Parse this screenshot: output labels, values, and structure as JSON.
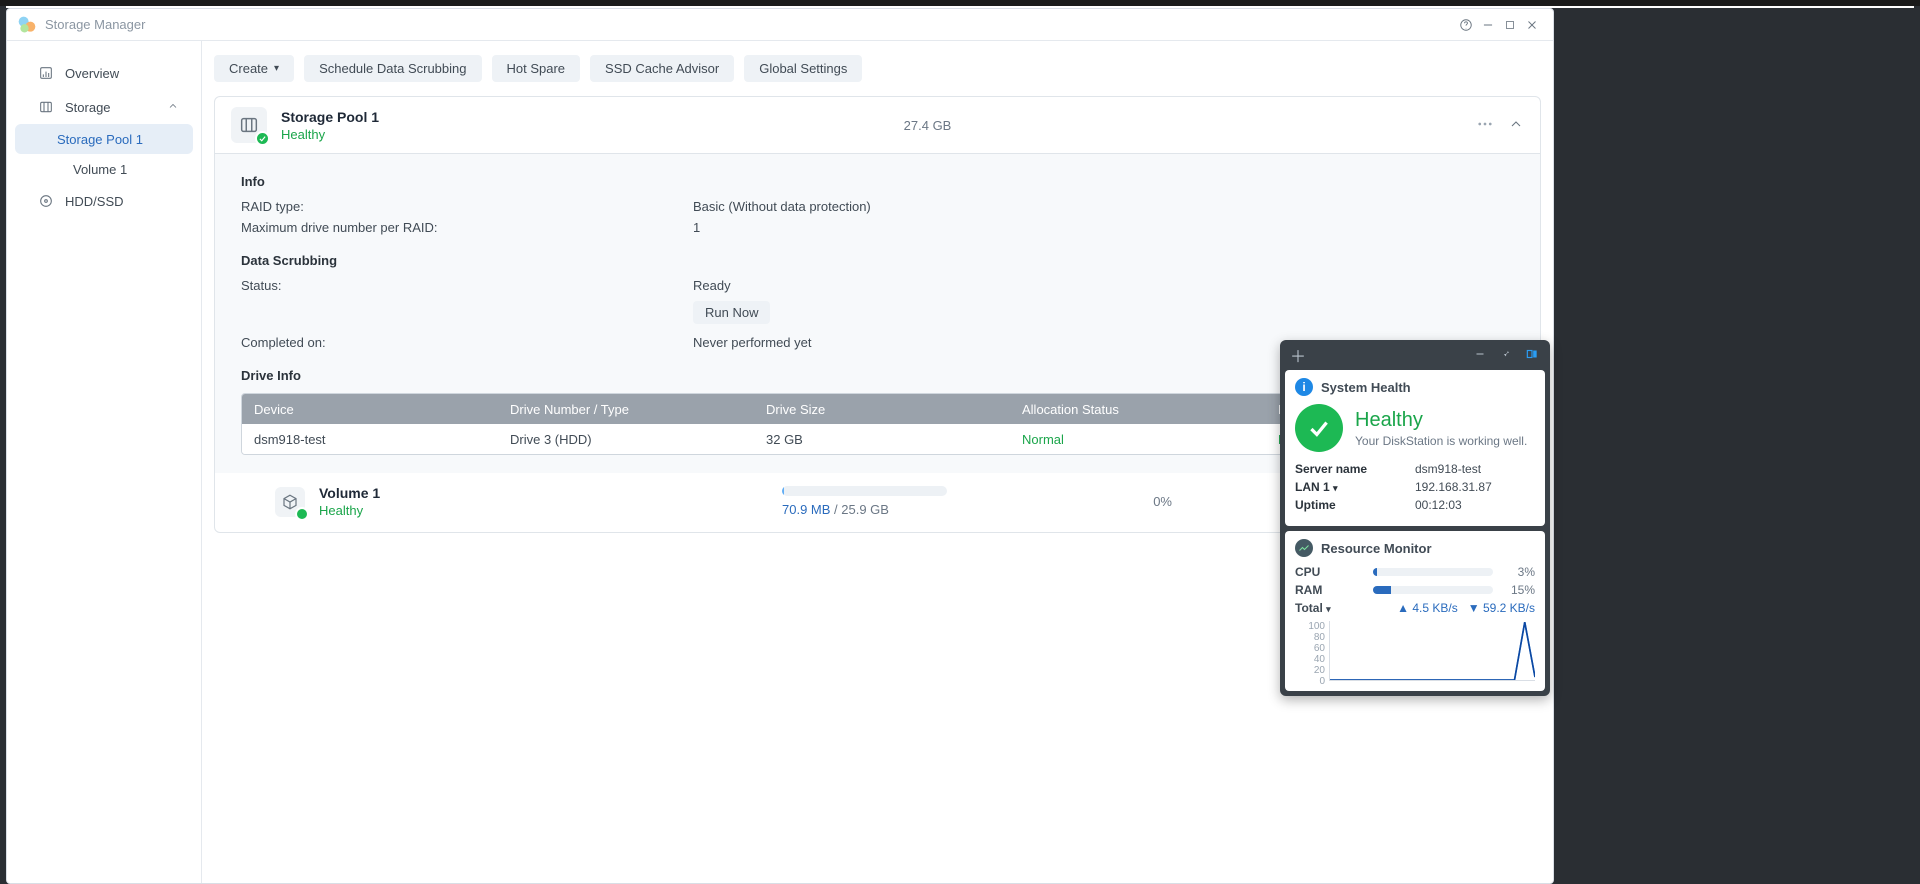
{
  "window": {
    "title": "Storage Manager"
  },
  "sidebar": {
    "overview": "Overview",
    "storage": "Storage",
    "storage_pool": "Storage Pool 1",
    "volume": "Volume 1",
    "hddssd": "HDD/SSD"
  },
  "toolbar": {
    "create": "Create",
    "schedule": "Schedule Data Scrubbing",
    "hotspare": "Hot Spare",
    "ssdcache": "SSD Cache Advisor",
    "global": "Global Settings"
  },
  "pool": {
    "name": "Storage Pool 1",
    "status": "Healthy",
    "size": "27.4 GB",
    "info_title": "Info",
    "raid_type_k": "RAID type:",
    "raid_type_v": "Basic (Without data protection)",
    "max_drive_k": "Maximum drive number per RAID:",
    "max_drive_v": "1",
    "scrub_title": "Data Scrubbing",
    "scrub_status_k": "Status:",
    "scrub_status_v": "Ready",
    "scrub_run_now": "Run Now",
    "scrub_completed_k": "Completed on:",
    "scrub_completed_v": "Never performed yet",
    "drive_title": "Drive Info"
  },
  "drive_table": {
    "head": {
      "device": "Device",
      "num": "Drive Number / Type",
      "size": "Drive Size",
      "alloc": "Allocation Status",
      "health": "Health Status"
    },
    "rows": [
      {
        "device": "dsm918-test",
        "num": "Drive 3 (HDD)",
        "size": "32 GB",
        "alloc": "Normal",
        "health": "Healthy"
      }
    ]
  },
  "volume": {
    "name": "Volume 1",
    "status": "Healthy",
    "used": "70.9 MB",
    "total": "25.9 GB",
    "sep": " / ",
    "percent": "0%"
  },
  "widget": {
    "syshealth_title": "System Health",
    "healthy": "Healthy",
    "healthy_sub": "Your DiskStation is working well.",
    "server_name_k": "Server name",
    "server_name_v": "dsm918-test",
    "lan_k": "LAN 1",
    "lan_v": "192.168.31.87",
    "uptime_k": "Uptime",
    "uptime_v": "00:12:03",
    "resmon_title": "Resource Monitor",
    "cpu_k": "CPU",
    "cpu_pct": "3%",
    "ram_k": "RAM",
    "ram_pct": "15%",
    "total_k": "Total",
    "up": "4.5 KB/s",
    "down": "59.2 KB/s"
  },
  "chart_data": {
    "type": "line",
    "ylabel": "",
    "xlabel": "",
    "ylim": [
      0,
      100
    ],
    "yticks": [
      0,
      20,
      40,
      60,
      80,
      100
    ],
    "series": [
      {
        "name": "network-up",
        "color": "#1e88e5",
        "values": [
          0,
          0,
          0,
          0,
          0,
          0,
          0,
          0,
          0,
          0,
          0,
          0,
          0,
          0,
          0,
          0,
          0,
          0,
          0,
          98,
          5
        ]
      },
      {
        "name": "network-down",
        "color": "#0d47a1",
        "values": [
          0,
          0,
          0,
          0,
          0,
          0,
          0,
          0,
          0,
          0,
          0,
          0,
          0,
          0,
          0,
          0,
          0,
          0,
          0,
          98,
          5
        ]
      }
    ]
  }
}
